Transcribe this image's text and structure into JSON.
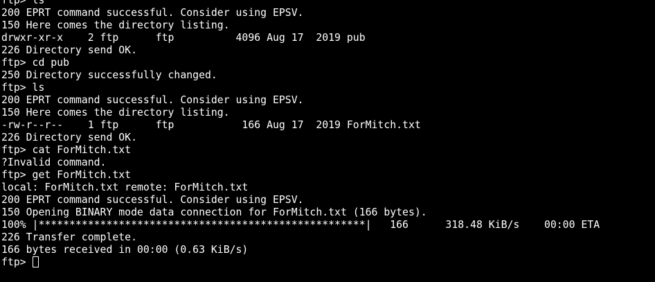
{
  "terminal": {
    "lines": [
      "ftp> ls",
      "200 EPRT command successful. Consider using EPSV.",
      "150 Here comes the directory listing.",
      "drwxr-xr-x    2 ftp      ftp          4096 Aug 17  2019 pub",
      "226 Directory send OK.",
      "ftp> cd pub",
      "250 Directory successfully changed.",
      "ftp> ls",
      "200 EPRT command successful. Consider using EPSV.",
      "150 Here comes the directory listing.",
      "-rw-r--r--    1 ftp      ftp           166 Aug 17  2019 ForMitch.txt",
      "226 Directory send OK.",
      "ftp> cat ForMitch.txt",
      "?Invalid command.",
      "ftp> get ForMitch.txt",
      "local: ForMitch.txt remote: ForMitch.txt",
      "200 EPRT command successful. Consider using EPSV.",
      "150 Opening BINARY mode data connection for ForMitch.txt (166 bytes).",
      "100% |*****************************************************|   166      318.48 KiB/s    00:00 ETA",
      "226 Transfer complete.",
      "166 bytes received in 00:00 (0.63 KiB/s)"
    ],
    "prompt": "ftp> ",
    "colors": {
      "background": "#000000",
      "foreground": "#ffffff"
    }
  }
}
